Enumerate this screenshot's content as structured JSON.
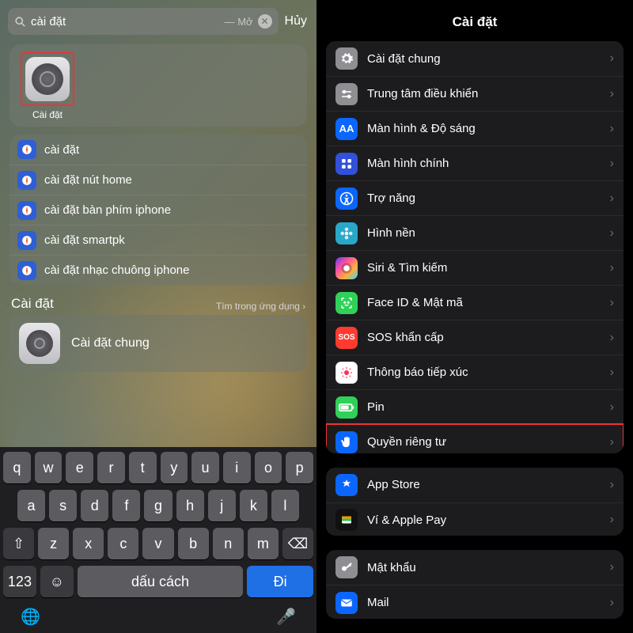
{
  "left": {
    "search": {
      "query": "cài đặt",
      "hint": "Mở"
    },
    "cancel": "Hủy",
    "appResult": {
      "caption": "Cài đặt"
    },
    "suggestions": [
      "cài đặt",
      "cài đặt nút home",
      "cài đặt bàn phím iphone",
      "cài đặt smartpk",
      "cài đặt nhạc chuông iphone"
    ],
    "section": {
      "title": "Cài đặt",
      "more": "Tìm trong ứng dụng"
    },
    "inAppResult": "Cài đặt chung",
    "keyboard": {
      "row1": [
        "q",
        "w",
        "e",
        "r",
        "t",
        "y",
        "u",
        "i",
        "o",
        "p"
      ],
      "row2": [
        "a",
        "s",
        "d",
        "f",
        "g",
        "h",
        "j",
        "k",
        "l"
      ],
      "row3_shift": "⇧",
      "row3": [
        "z",
        "x",
        "c",
        "v",
        "b",
        "n",
        "m"
      ],
      "row3_del": "⌫",
      "numKey": "123",
      "emoji": "☺",
      "space": "dấu cách",
      "go": "Đi",
      "globe": "🌐",
      "mic": "🎤"
    }
  },
  "right": {
    "title": "Cài đặt",
    "group1": [
      {
        "label": "Cài đặt chung",
        "icon": "gear",
        "cls": "ic-grey"
      },
      {
        "label": "Trung tâm điều khiển",
        "icon": "switches",
        "cls": "ic-grey"
      },
      {
        "label": "Màn hình & Độ sáng",
        "icon": "AA",
        "cls": "ic-blue"
      },
      {
        "label": "Màn hình chính",
        "icon": "grid",
        "cls": "ic-indigo"
      },
      {
        "label": "Trợ năng",
        "icon": "access",
        "cls": "ic-blue"
      },
      {
        "label": "Hình nền",
        "icon": "flower",
        "cls": "ic-cyan"
      },
      {
        "label": "Siri & Tìm kiếm",
        "icon": "siri",
        "cls": "ic-siri"
      },
      {
        "label": "Face ID & Mật mã",
        "icon": "face",
        "cls": "ic-green"
      },
      {
        "label": "SOS khẩn cấp",
        "icon": "SOS",
        "cls": "ic-red"
      },
      {
        "label": "Thông báo tiếp xúc",
        "icon": "exposure",
        "cls": "ic-pink"
      },
      {
        "label": "Pin",
        "icon": "battery",
        "cls": "ic-battery"
      },
      {
        "label": "Quyền riêng tư",
        "icon": "hand",
        "cls": "ic-blue",
        "highlight": true
      }
    ],
    "group2": [
      {
        "label": "App Store",
        "icon": "appstore",
        "cls": "ic-blue"
      },
      {
        "label": "Ví & Apple Pay",
        "icon": "wallet",
        "cls": "ic-black"
      }
    ],
    "group3": [
      {
        "label": "Mật khẩu",
        "icon": "key",
        "cls": "ic-grey"
      },
      {
        "label": "Mail",
        "icon": "mail",
        "cls": "ic-blue"
      }
    ]
  }
}
